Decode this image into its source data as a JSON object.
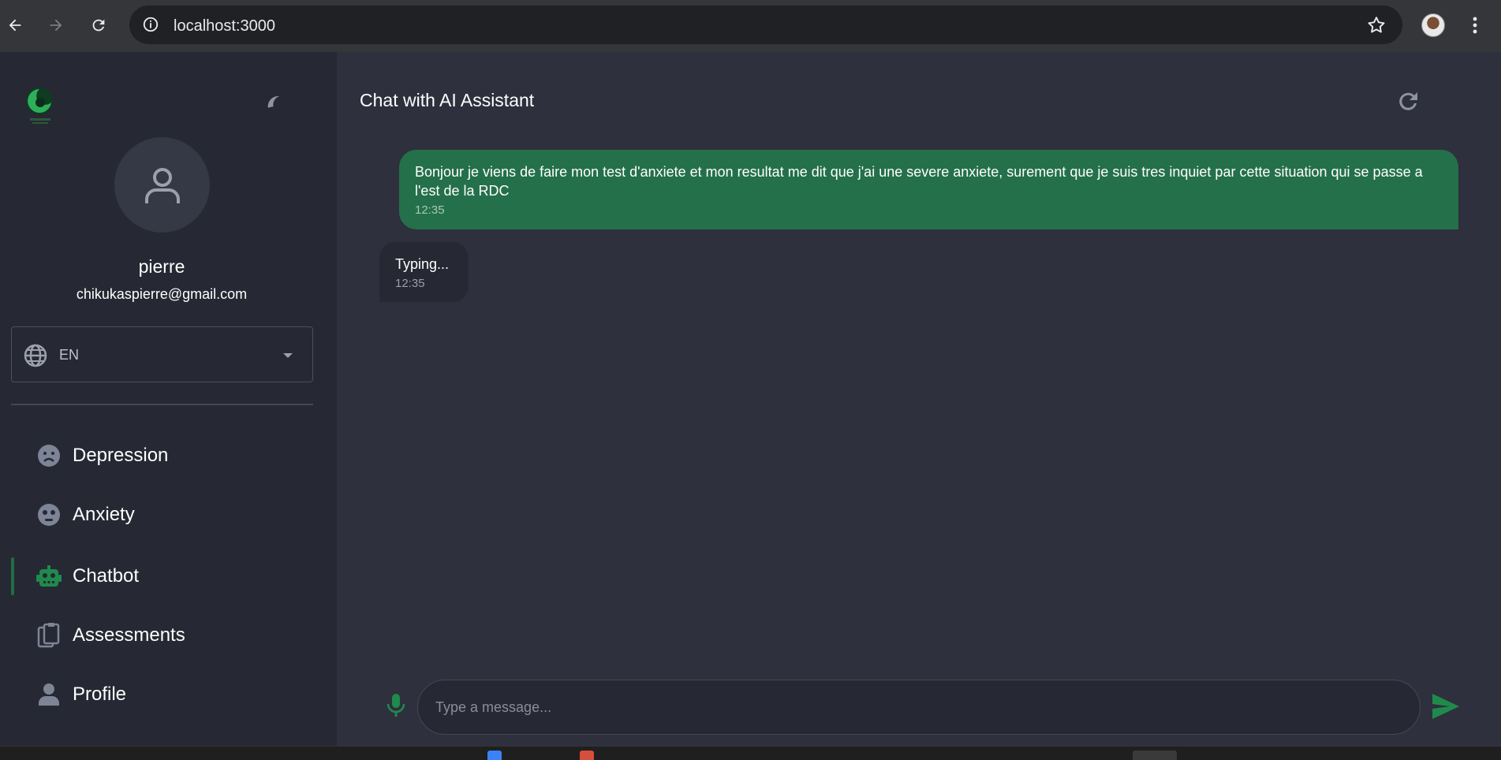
{
  "browser": {
    "url": "localhost:3000",
    "icons": [
      "back-arrow-icon",
      "forward-arrow-icon",
      "reload-icon",
      "site-info-icon",
      "bookmark-star-icon",
      "profile-avatar",
      "more-menu-icon"
    ]
  },
  "sidebar": {
    "user": {
      "name": "pierre",
      "email": "chikukaspierre@gmail.com"
    },
    "language": {
      "selected": "EN"
    },
    "nav": [
      {
        "label": "Depression",
        "icon": "sad-face-icon",
        "active": false
      },
      {
        "label": "Anxiety",
        "icon": "anxious-face-icon",
        "active": false
      },
      {
        "label": "Chatbot",
        "icon": "robot-icon",
        "active": true
      },
      {
        "label": "Assessments",
        "icon": "clipboard-icon",
        "active": false
      },
      {
        "label": "Profile",
        "icon": "person-icon",
        "active": false
      }
    ]
  },
  "chat": {
    "title": "Chat with AI Assistant",
    "messages": [
      {
        "sender": "user",
        "text": "Bonjour je viens de faire mon test d'anxiete et mon resultat me dit que j'ai une severe anxiete, surement que je suis tres inquiet par cette situation qui se passe a l'est de la RDC",
        "time": "12:35"
      },
      {
        "sender": "assistant",
        "text": "Typing...",
        "time": "12:35"
      }
    ],
    "input": {
      "placeholder": "Type a message...",
      "value": ""
    }
  },
  "colors": {
    "accent_green": "#24704a",
    "sidebar_bg": "#262833",
    "main_bg": "#2e303d"
  }
}
